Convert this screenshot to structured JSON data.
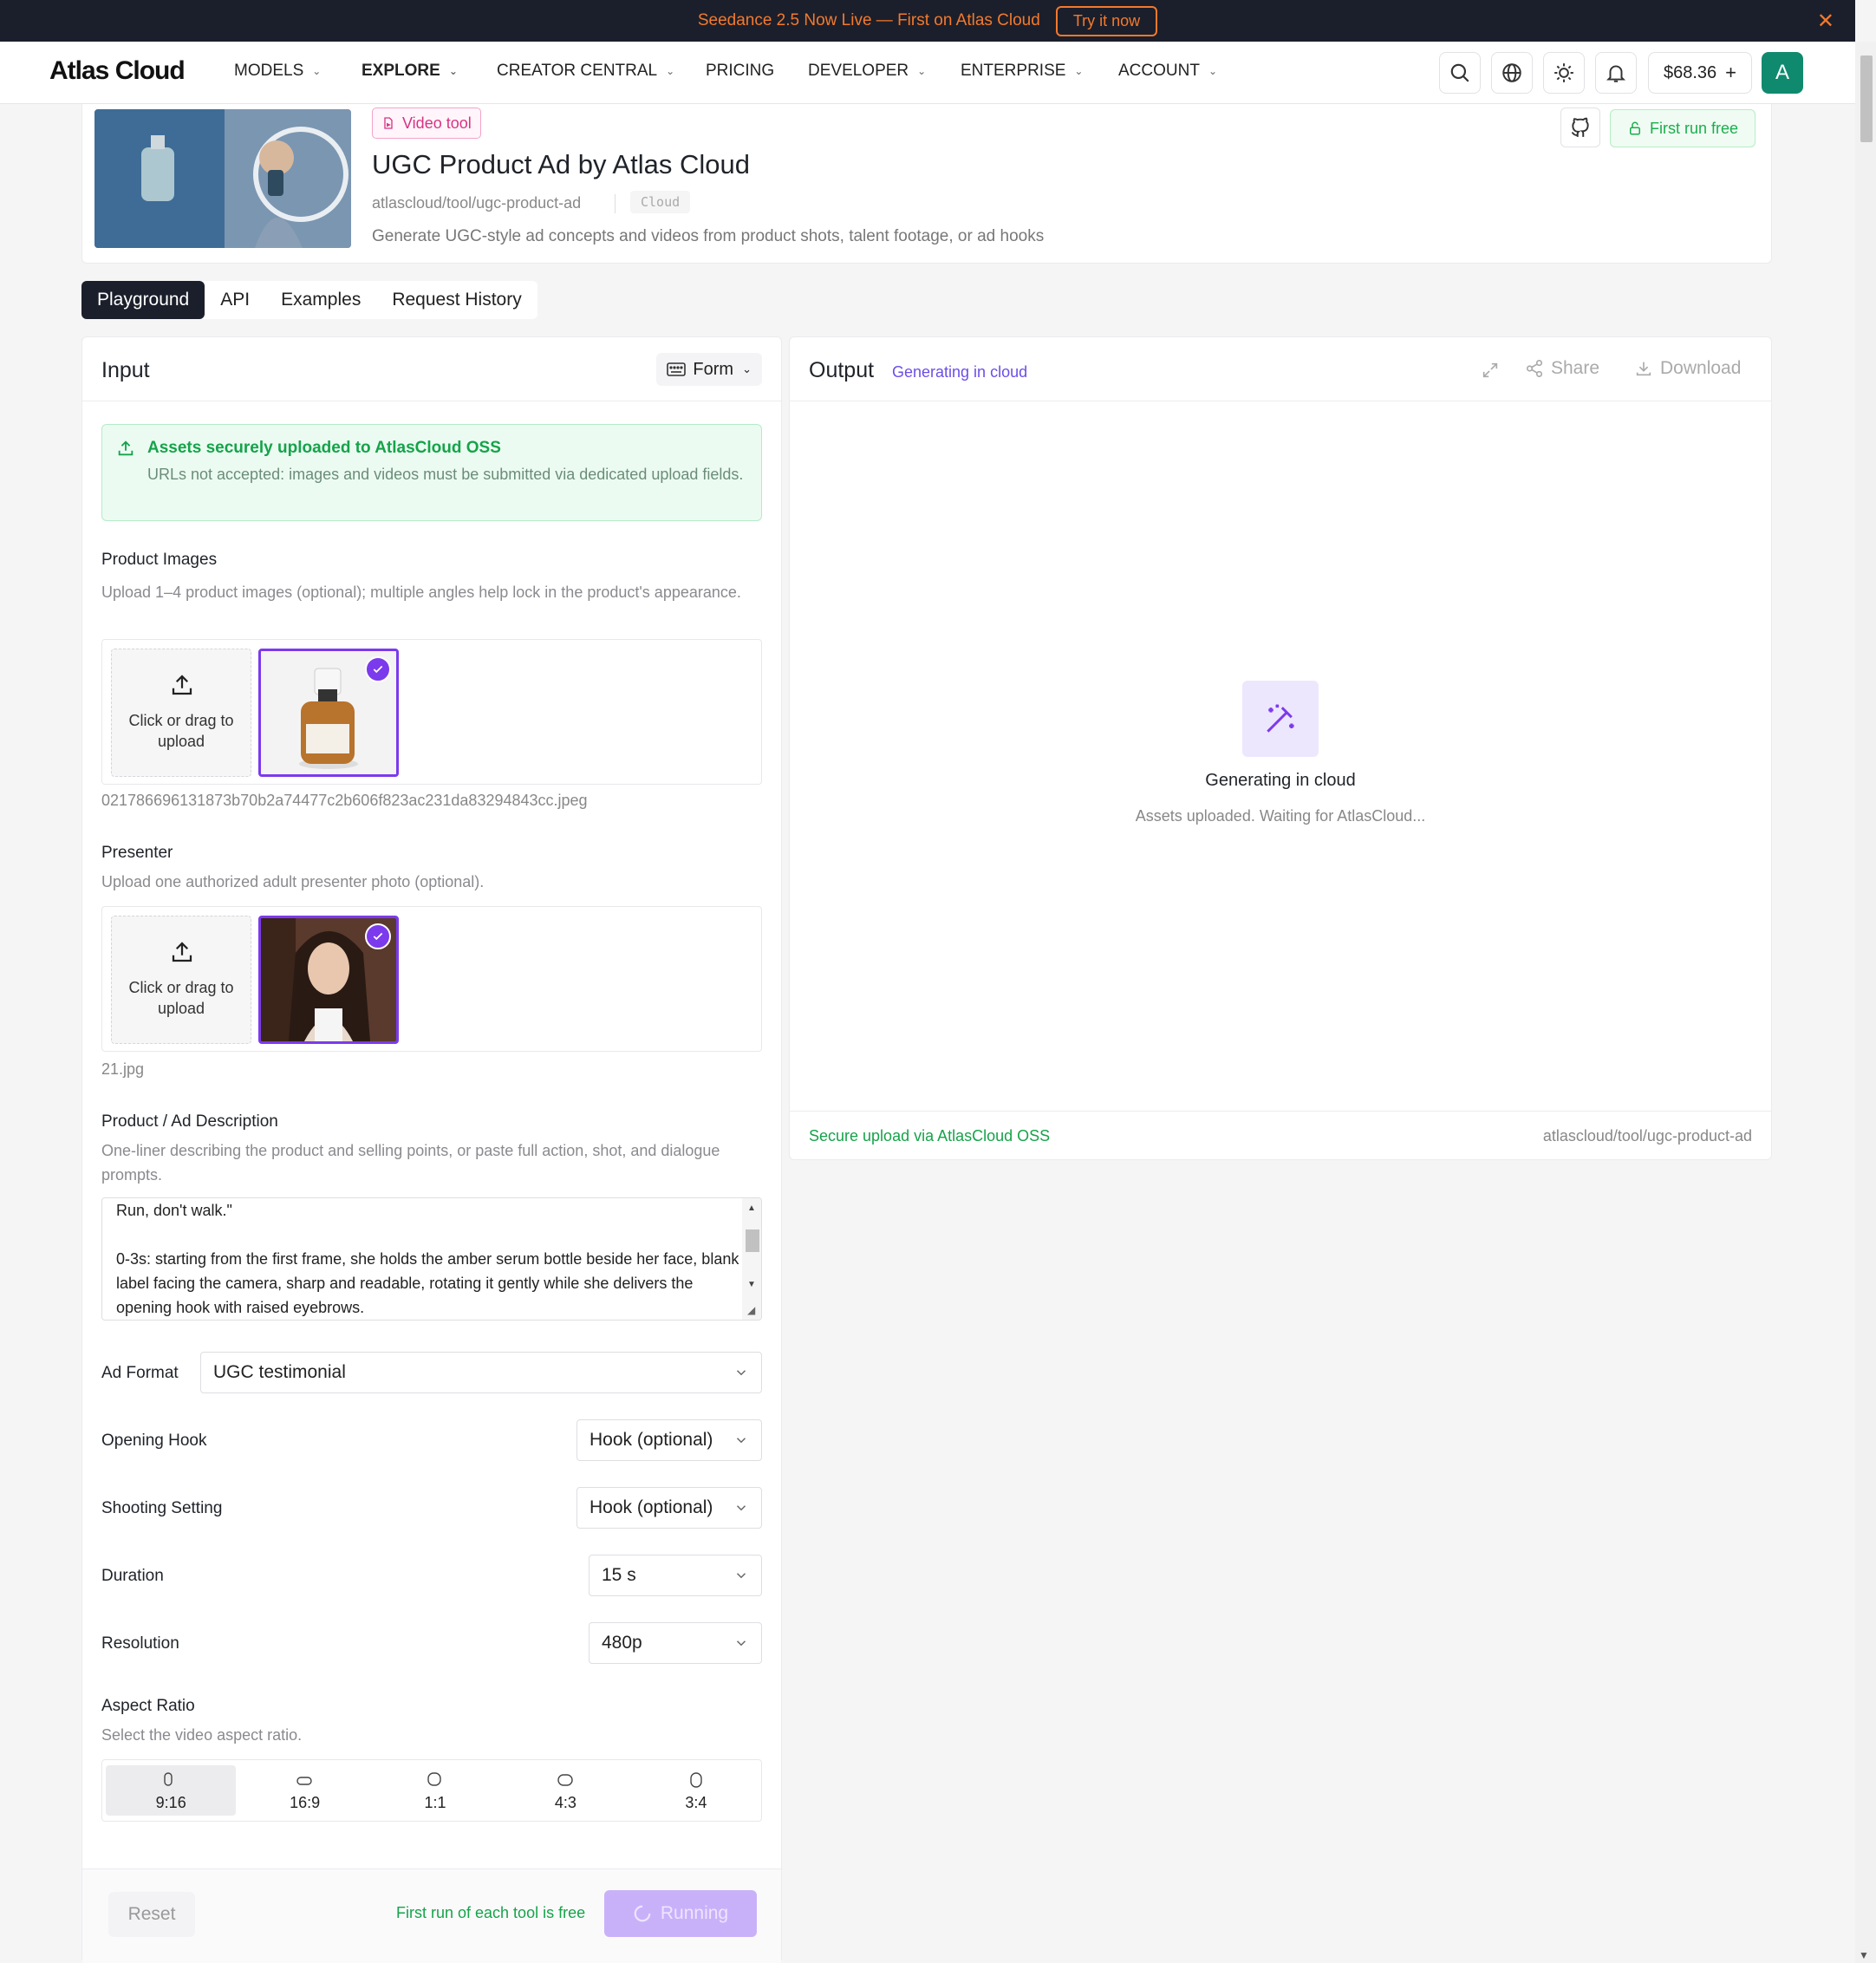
{
  "announcement": {
    "message": "Seedance 2.5 Now Live — First on Atlas Cloud",
    "cta": "Try it now"
  },
  "header": {
    "logo": "Atlas Cloud",
    "nav": [
      "MODELS",
      "EXPLORE",
      "CREATOR CENTRAL",
      "PRICING",
      "DEVELOPER",
      "ENTERPRISE",
      "ACCOUNT"
    ],
    "balance": "$68.36",
    "avatar_letter": "A"
  },
  "tool": {
    "badge": "Video tool",
    "title": "UGC Product Ad by Atlas Cloud",
    "slug": "atlascloud/tool/ugc-product-ad",
    "tag": "Cloud",
    "description": "Generate UGC-style ad concepts and videos from product shots, talent footage, or ad hooks",
    "free_button": "First run free"
  },
  "tabs": [
    "Playground",
    "API",
    "Examples",
    "Request History"
  ],
  "input": {
    "title": "Input",
    "mode": "Form",
    "notice_title": "Assets securely uploaded to AtlasCloud OSS",
    "notice_body": "URLs not accepted: images and videos must be submitted via dedicated upload fields.",
    "product_images": {
      "label": "Product Images",
      "hint": "Upload 1–4 product images (optional); multiple angles help lock in the product's appearance.",
      "drop_text": "Click or drag to upload",
      "filename": "021786696131873b70b2a74477c2b606f823ac231da83294843cc.jpeg"
    },
    "presenter": {
      "label": "Presenter",
      "hint": "Upload one authorized adult presenter photo (optional).",
      "drop_text": "Click or drag to upload",
      "filename": "21.jpg"
    },
    "description": {
      "label": "Product / Ad Description",
      "hint": "One-liner describing the product and selling points, or paste full action, shot, and dialogue prompts.",
      "value": "Run, don't walk.\"\n\n0-3s: starting from the first frame, she holds the amber serum bottle beside her face, blank label facing the camera, sharp and readable, rotating it gently while she delivers the opening hook with raised eyebrows."
    },
    "ad_format": {
      "label": "Ad Format",
      "value": "UGC testimonial"
    },
    "opening_hook": {
      "label": "Opening Hook",
      "value": "Hook (optional)"
    },
    "shooting_setting": {
      "label": "Shooting Setting",
      "value": "Hook (optional)"
    },
    "duration": {
      "label": "Duration",
      "value": "15 s"
    },
    "resolution": {
      "label": "Resolution",
      "value": "480p"
    },
    "aspect": {
      "label": "Aspect Ratio",
      "hint": "Select the video aspect ratio.",
      "options": [
        "9:16",
        "16:9",
        "1:1",
        "4:3",
        "3:4"
      ],
      "selected": "9:16"
    },
    "reset": "Reset",
    "free_note": "First run of each tool is free",
    "run": "Running"
  },
  "output": {
    "title": "Output",
    "status": "Generating in cloud",
    "share": "Share",
    "download": "Download",
    "gen_title": "Generating in cloud",
    "gen_sub": "Assets uploaded. Waiting for AtlasCloud...",
    "foot_left": "Secure upload via AtlasCloud OSS",
    "foot_right": "atlascloud/tool/ugc-product-ad"
  },
  "colors": {
    "accent": "#7c3aed",
    "green": "#16a34a",
    "dark": "#1b1f2b",
    "orange": "#f4792c"
  }
}
